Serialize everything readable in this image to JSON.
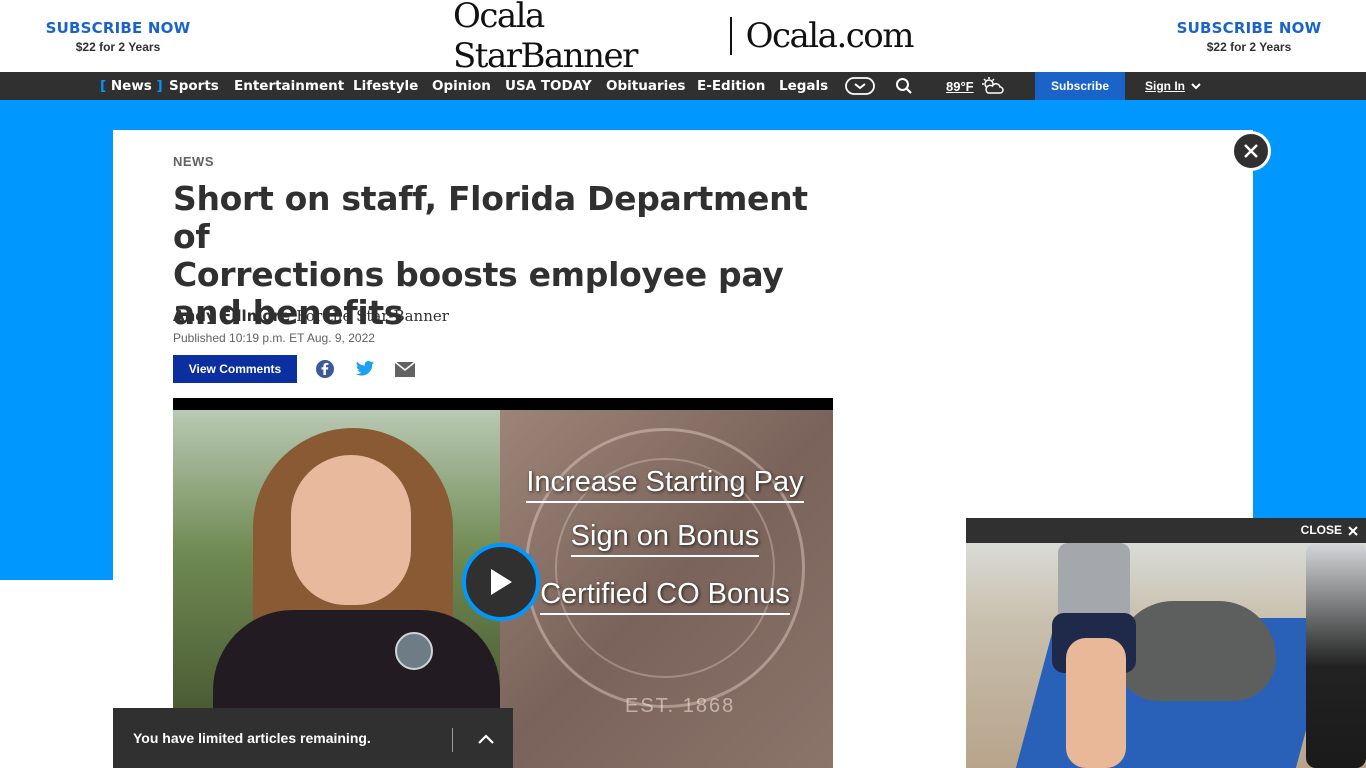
{
  "masthead": {
    "subscribe_left": {
      "title": "SUBSCRIBE NOW",
      "price": "$22 for 2 Years"
    },
    "subscribe_right": {
      "title": "SUBSCRIBE NOW",
      "price": "$22 for 2 Years"
    },
    "logo_left": "Ocala StarBanner",
    "logo_right": "Ocala.com"
  },
  "nav": {
    "items": [
      "News",
      "Sports",
      "Entertainment",
      "Lifestyle",
      "Opinion",
      "USA TODAY",
      "Obituaries",
      "E-Edition",
      "Legals"
    ],
    "active_index": 0,
    "weather": "89°F",
    "subscribe": "Subscribe",
    "signin": "Sign In"
  },
  "article": {
    "section": "NEWS",
    "headline_lines": [
      "Short on staff, Florida Department of",
      "Corrections boosts employee pay",
      "and benefits"
    ],
    "author": "Andy Fillmore",
    "affiliation": "For the Star-Banner",
    "published": "Published 10:19 p.m. ET Aug. 9, 2022",
    "view_comments": "View Comments"
  },
  "video": {
    "lines": [
      "Increase Starting Pay",
      "Sign on Bonus",
      "Certified CO Bonus"
    ],
    "seal_text": "EST. 1868"
  },
  "limit_bar": {
    "text": "You have limited articles remaining."
  },
  "float_video": {
    "close_label": "CLOSE"
  },
  "colors": {
    "brand_blue": "#0098fe",
    "accent_blue": "#1a63c8",
    "nav_dark": "#303030",
    "comments_blue": "#0b2ea1"
  }
}
